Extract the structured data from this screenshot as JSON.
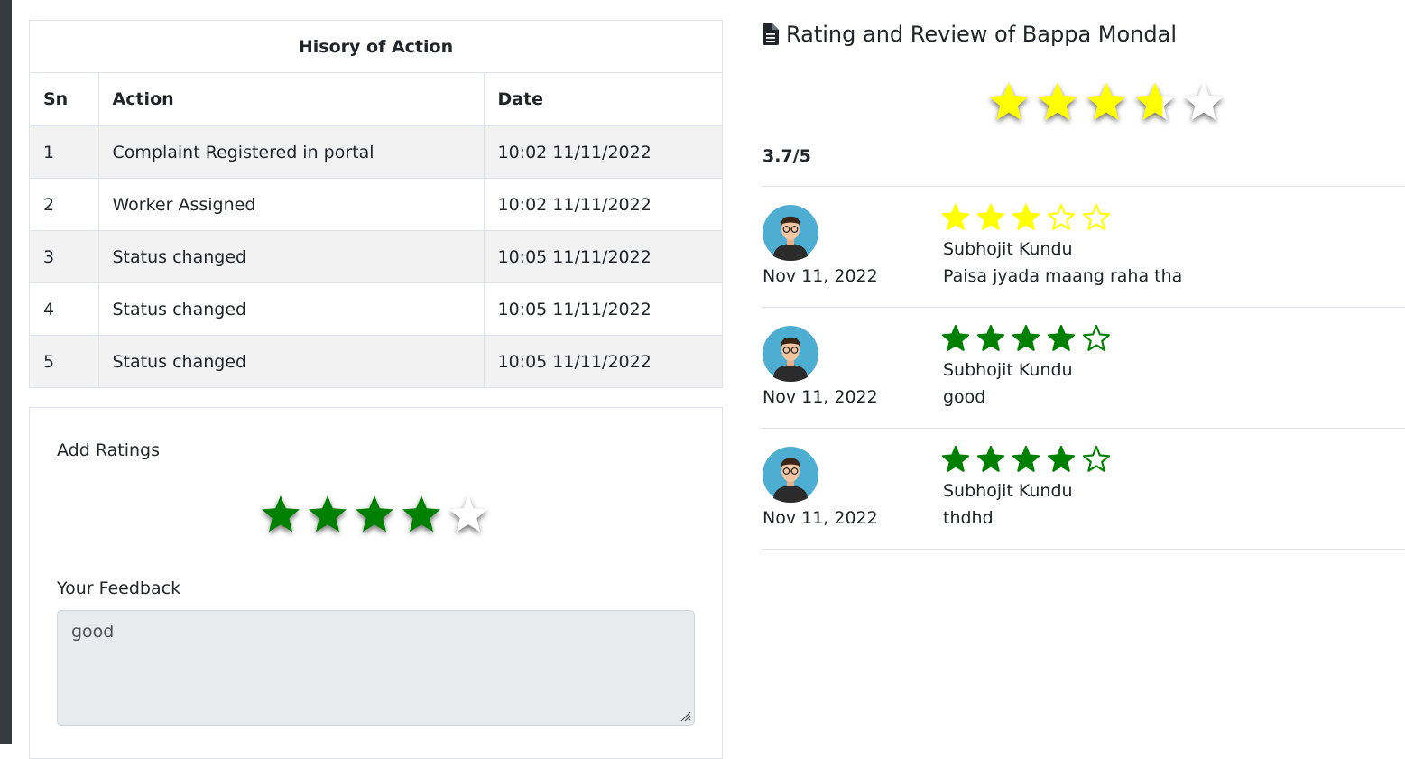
{
  "history": {
    "caption": "Hisory of Action",
    "columns": [
      "Sn",
      "Action",
      "Date"
    ],
    "rows": [
      {
        "sn": "1",
        "action": "Complaint Registered in portal",
        "date": "10:02 11/11/2022"
      },
      {
        "sn": "2",
        "action": "Worker Assigned",
        "date": "10:02 11/11/2022"
      },
      {
        "sn": "3",
        "action": "Status changed",
        "date": "10:05 11/11/2022"
      },
      {
        "sn": "4",
        "action": "Status changed",
        "date": "10:05 11/11/2022"
      },
      {
        "sn": "5",
        "action": "Status changed",
        "date": "10:05 11/11/2022"
      }
    ]
  },
  "add_rating": {
    "label": "Add Ratings",
    "selected_stars": 4,
    "max_stars": 5,
    "star_color": "#008000",
    "feedback_label": "Your Feedback",
    "feedback_value": "good"
  },
  "overall": {
    "title": "Rating and Review of Bappa Mondal",
    "title_icon": "file-text-icon",
    "rating": 3.7,
    "max": 5,
    "score_text": "3.7/5",
    "star_color": "#ffff00"
  },
  "reviews": [
    {
      "date": "Nov 11, 2022",
      "name": "Subhojit Kundu",
      "text": "Paisa jyada maang raha tha",
      "stars": 3,
      "color": "#ffff00"
    },
    {
      "date": "Nov 11, 2022",
      "name": "Subhojit Kundu",
      "text": "good",
      "stars": 4,
      "color": "#008000"
    },
    {
      "date": "Nov 11, 2022",
      "name": "Subhojit Kundu",
      "text": "thdhd",
      "stars": 4,
      "color": "#008000"
    }
  ]
}
